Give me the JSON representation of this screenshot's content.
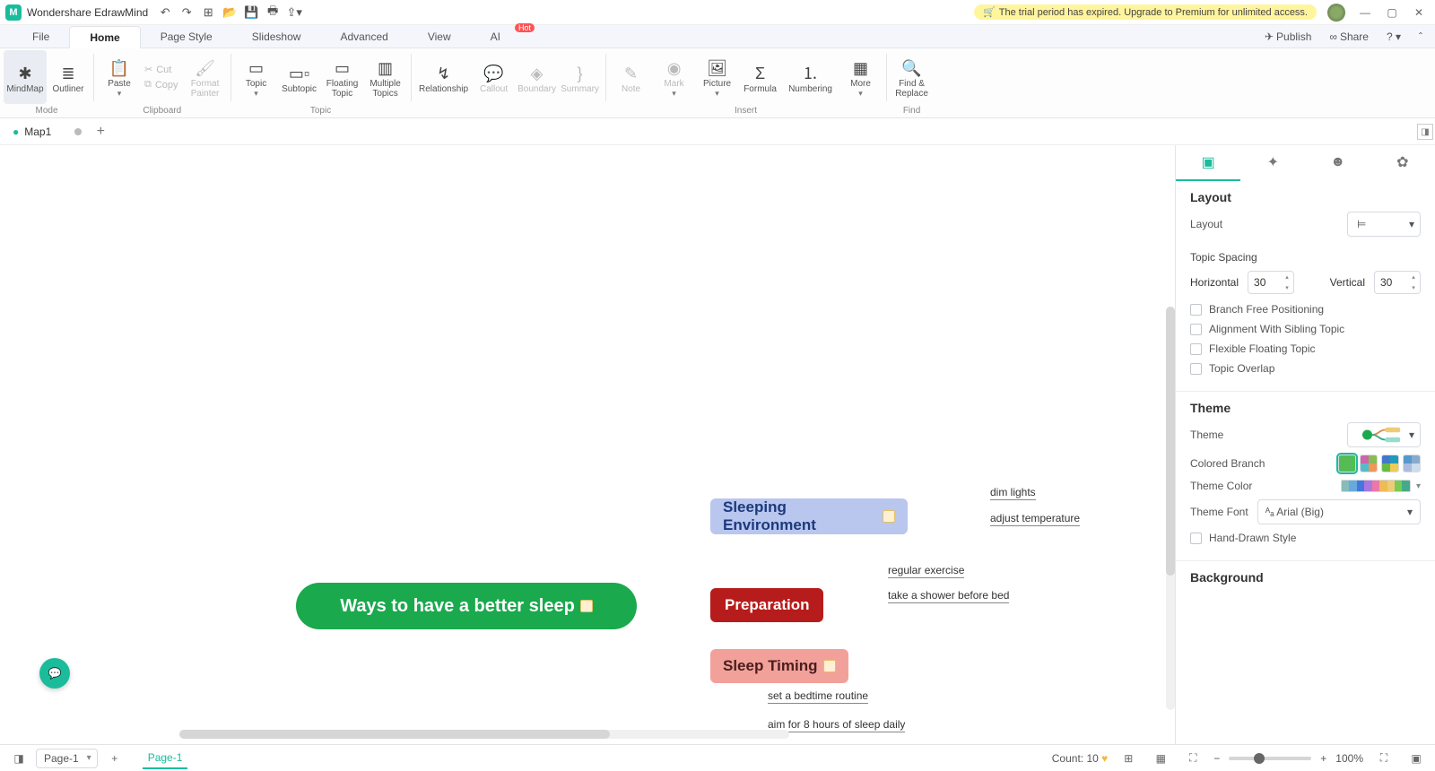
{
  "app_title": "Wondershare EdrawMind",
  "trial_text": "The trial period has expired. Upgrade to Premium for unlimited access.",
  "menu": {
    "file": "File",
    "home": "Home",
    "page_style": "Page Style",
    "slideshow": "Slideshow",
    "advanced": "Advanced",
    "view": "View",
    "ai": "AI",
    "hot": "Hot"
  },
  "menu_right": {
    "publish": "Publish",
    "share": "Share"
  },
  "ribbon": {
    "mode": {
      "mindmap": "MindMap",
      "outliner": "Outliner",
      "label": "Mode"
    },
    "clipboard": {
      "paste": "Paste",
      "cut": "Cut",
      "copy": "Copy",
      "format_painter": "Format\nPainter",
      "label": "Clipboard"
    },
    "topic": {
      "topic": "Topic",
      "subtopic": "Subtopic",
      "floating": "Floating\nTopic",
      "multiple": "Multiple\nTopics",
      "label": "Topic"
    },
    "misc": {
      "relationship": "Relationship",
      "callout": "Callout",
      "boundary": "Boundary",
      "summary": "Summary"
    },
    "insert": {
      "note": "Note",
      "mark": "Mark",
      "picture": "Picture",
      "formula": "Formula",
      "numbering": "Numbering",
      "more": "More",
      "label": "Insert"
    },
    "find": {
      "find_replace": "Find &\nReplace",
      "label": "Find"
    }
  },
  "doctab": "Map1",
  "mindmap": {
    "root": "Ways to have a  better sleep",
    "b1": "Sleeping Environment",
    "b1_c1": "dim lights",
    "b1_c2": "adjust temperature",
    "b2": "Preparation",
    "b2_c1": "regular exercise",
    "b2_c2": "take a shower before bed",
    "b3": "Sleep Timing",
    "b3_c1": "set a bedtime routine",
    "b3_c2": "aim for 8 hours of sleep daily"
  },
  "panel": {
    "layout_h": "Layout",
    "layout_label": "Layout",
    "spacing": "Topic Spacing",
    "horizontal": "Horizontal",
    "horizontal_v": "30",
    "vertical": "Vertical",
    "vertical_v": "30",
    "branch_free": "Branch Free Positioning",
    "align_sibling": "Alignment With Sibling Topic",
    "flexible_float": "Flexible Floating Topic",
    "overlap": "Topic Overlap",
    "theme_h": "Theme",
    "theme_label": "Theme",
    "colored_branch": "Colored Branch",
    "theme_color": "Theme Color",
    "theme_font": "Theme Font",
    "theme_font_v": "Arial (Big)",
    "hand_drawn": "Hand-Drawn Style",
    "background_h": "Background"
  },
  "footer": {
    "page_sel": "Page-1",
    "page_tab": "Page-1",
    "count": "Count: 10",
    "zoom": "100%"
  }
}
